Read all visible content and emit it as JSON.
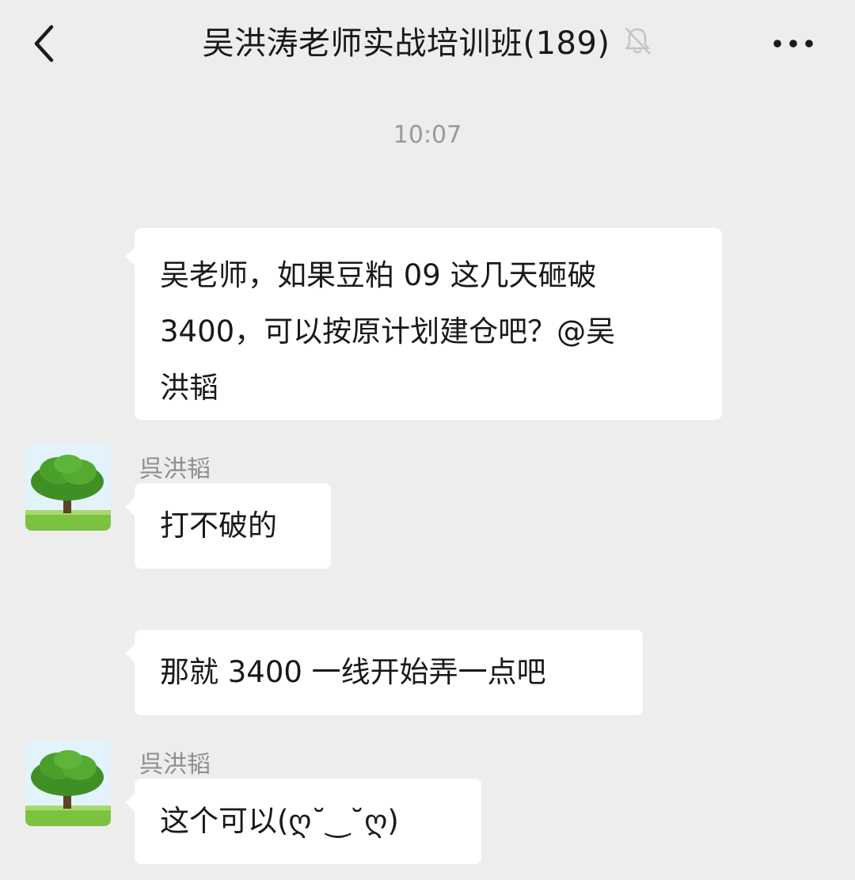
{
  "header": {
    "title": "吴洪涛老师实战培训班(189)"
  },
  "icons": {
    "back": "chevron-left-icon",
    "mute": "bell-muted-icon",
    "more": "more-horizontal-icon",
    "avatar": "tree-avatar"
  },
  "timestamp": "10:07",
  "messages": [
    {
      "sender": "",
      "text": "吴老师，如果豆粕 09 这几天砸破\n3400，可以按原计划建仓吧？@吴\n洪韬"
    },
    {
      "sender": "呉洪韬",
      "text": "打不破的"
    },
    {
      "sender": "",
      "text": "那就 3400 一线开始弄一点吧"
    },
    {
      "sender": "呉洪韬",
      "text": "这个可以(ღ˘‿˘ღ)"
    }
  ],
  "colors": {
    "background": "#ededed",
    "bubble": "#ffffff",
    "timestamp": "#9a9a9a",
    "sender": "#8e8e8e"
  }
}
